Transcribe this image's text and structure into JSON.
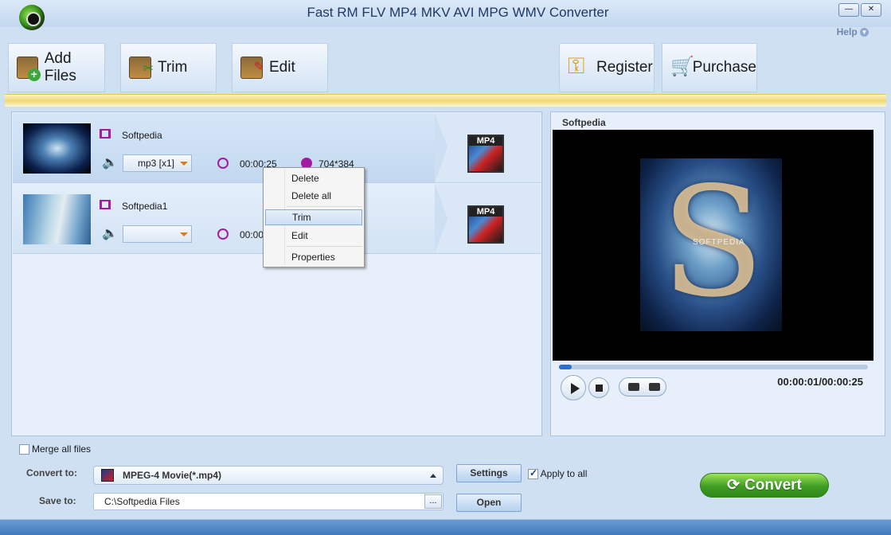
{
  "window": {
    "title": "Fast RM FLV MP4 MKV AVI MPG WMV Converter",
    "minimize": "—",
    "close": "✕",
    "help": "Help"
  },
  "toolbar": {
    "add_files": "Add Files",
    "trim": "Trim",
    "edit": "Edit",
    "register": "Register",
    "purchase": "Purchase"
  },
  "files": [
    {
      "name": "Softpedia",
      "audio": "mp3 [x1]",
      "duration": "00:00:25",
      "resolution": "704*384",
      "format_badge": "MP4",
      "selected": true
    },
    {
      "name": "Softpedia1",
      "audio": "",
      "duration": "00:00",
      "resolution": "",
      "format_badge": "MP4",
      "selected": false
    }
  ],
  "context_menu": {
    "items": [
      "Delete",
      "Delete all",
      "Trim",
      "Edit",
      "Properties"
    ],
    "highlighted": "Trim"
  },
  "preview": {
    "title": "Softpedia",
    "watermark": "SOFTPEDIA",
    "time": "00:00:01/00:00:25",
    "progress_fraction": 0.04
  },
  "bottom": {
    "merge_label": "Merge all files",
    "merge_checked": false,
    "convert_to_label": "Convert to:",
    "convert_to_value": "MPEG-4 Movie(*.mp4)",
    "save_to_label": "Save to:",
    "save_to_value": "C:\\Softpedia Files",
    "browse": "...",
    "settings": "Settings",
    "open": "Open",
    "apply_to_all": "Apply to all",
    "apply_checked": true,
    "convert": "Convert"
  },
  "colors": {
    "accent_purple": "#a21ca2",
    "convert_green": "#3f9e23",
    "status_blue": "#3f78bd"
  },
  "icons": [
    "app-logo-icon",
    "add-files-icon",
    "trim-icon",
    "edit-icon",
    "register-key-icon",
    "purchase-cart-icon",
    "film-icon",
    "speaker-icon",
    "clock-icon",
    "resolution-icon",
    "mp4-format-icon",
    "play-icon",
    "stop-icon",
    "camera-icon",
    "folder-icon",
    "refresh-icon"
  ]
}
